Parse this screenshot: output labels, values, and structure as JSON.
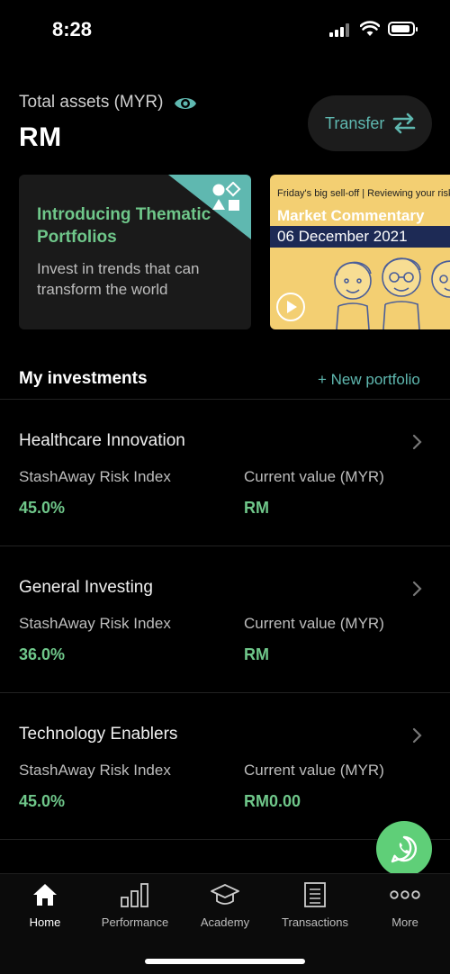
{
  "status_bar": {
    "time": "8:28"
  },
  "header": {
    "assets_label": "Total assets (MYR)",
    "assets_value": "RM",
    "transfer_label": "Transfer"
  },
  "cards": {
    "thematic": {
      "title": "Introducing Thematic Portfolios",
      "description": "Invest in trends that can transform the world"
    },
    "market": {
      "top_text": "Friday's big sell-off | Reviewing your risk",
      "title": "Market Commentary",
      "date": "06 December 2021"
    }
  },
  "investments": {
    "title": "My investments",
    "new_portfolio_label": "+ New portfolio",
    "portfolios": [
      {
        "name": "Healthcare Innovation",
        "risk_label": "StashAway Risk Index",
        "risk_value": "45.0%",
        "cv_label": "Current value (MYR)",
        "cv_value": "RM"
      },
      {
        "name": "General Investing",
        "risk_label": "StashAway Risk Index",
        "risk_value": "36.0%",
        "cv_label": "Current value (MYR)",
        "cv_value": "RM"
      },
      {
        "name": "Technology Enablers",
        "risk_label": "StashAway Risk Index",
        "risk_value": "45.0%",
        "cv_label": "Current value (MYR)",
        "cv_value": "RM0.00"
      }
    ]
  },
  "tab_bar": {
    "tabs": [
      {
        "label": "Home",
        "icon": "home-icon",
        "active": true
      },
      {
        "label": "Performance",
        "icon": "bar-chart-icon",
        "active": false
      },
      {
        "label": "Academy",
        "icon": "graduation-cap-icon",
        "active": false
      },
      {
        "label": "Transactions",
        "icon": "document-list-icon",
        "active": false
      },
      {
        "label": "More",
        "icon": "more-dots-icon",
        "active": false
      }
    ]
  },
  "colors": {
    "accent_teal": "#5fb8b0",
    "positive_green": "#6fc78a",
    "whatsapp_green": "#5fcf78",
    "background": "#000000",
    "market_card_yellow": "#f3cf72"
  }
}
